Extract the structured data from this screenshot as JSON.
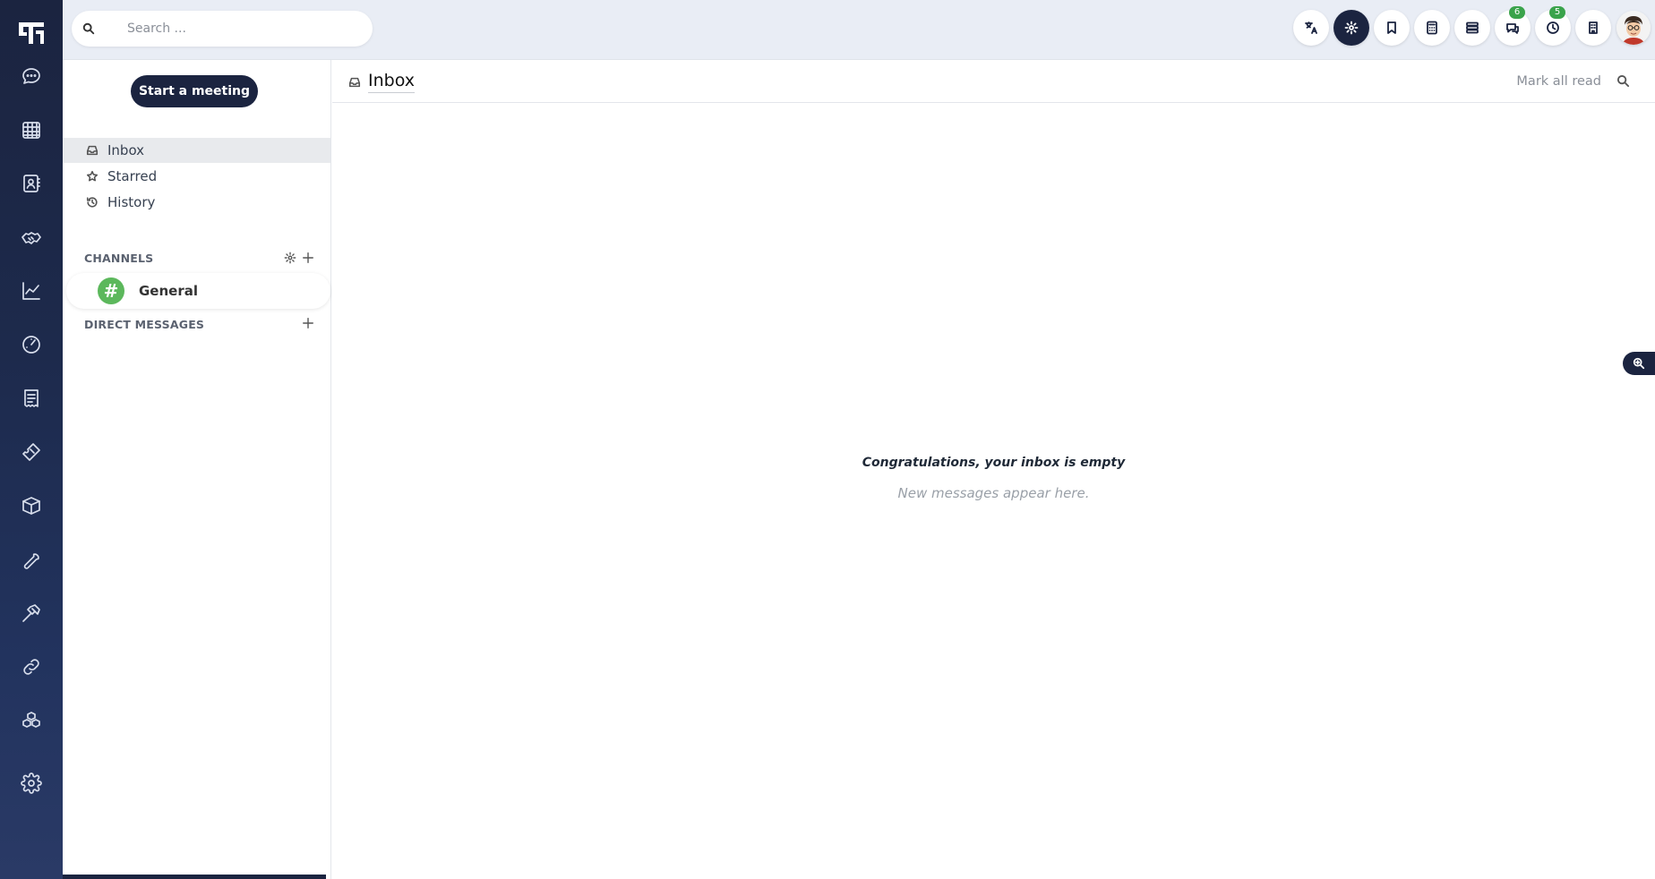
{
  "search": {
    "placeholder": "Search ..."
  },
  "sidebar": {
    "meeting_button": "Start a meeting",
    "nav": [
      {
        "label": "Inbox",
        "icon": "inbox-icon",
        "active": true
      },
      {
        "label": "Starred",
        "icon": "star-icon",
        "active": false
      },
      {
        "label": "History",
        "icon": "history-icon",
        "active": false
      }
    ],
    "channels_heading": "CHANNELS",
    "channels": [
      {
        "symbol": "#",
        "name": "General"
      }
    ],
    "dm_heading": "DIRECT MESSAGES"
  },
  "topbar": {
    "buttons": [
      "translate-icon",
      "settings-icon",
      "bookmark-icon",
      "calculator-icon",
      "server-icon",
      "chat-icon",
      "activity-icon",
      "building-icon"
    ],
    "chat_badge": "6",
    "activity_badge": "5"
  },
  "main": {
    "title": "Inbox",
    "mark_all_read": "Mark all read",
    "empty_title": "Congratulations, your inbox is empty",
    "empty_subtitle": "New messages appear here."
  },
  "colors": {
    "brand_dark": "#1b2440",
    "badge_green": "#3aa34b",
    "channel_green": "#5cb85c"
  }
}
